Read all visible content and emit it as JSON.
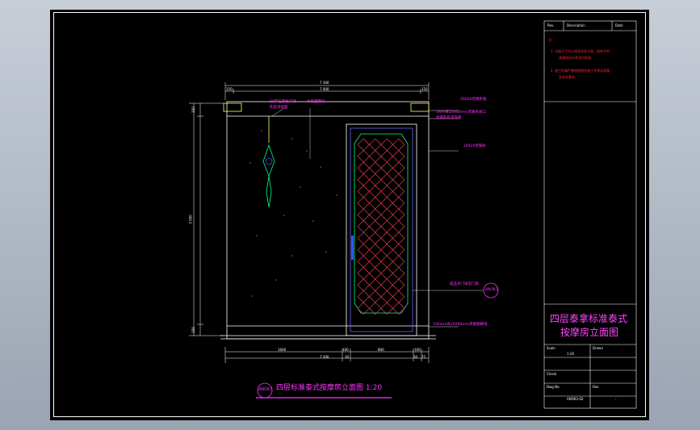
{
  "drawing": {
    "caption_tag": "ANOK3",
    "caption": "四层标准泰式按摩房立面图 1:20",
    "title_block": {
      "header_col1": "Rev.",
      "header_col2": "Description",
      "header_col3": "Date",
      "notes_label": "注:",
      "note_1": "1. 书面尺寸均以现场实际为准，如有不符",
      "note_1b": "请通知设计师及时修改。",
      "note_2": "2. 施工时请严格按照图纸施工并保证质量",
      "note_2b": "及安全要求。",
      "project_title_line1": "四层泰拿标准泰式",
      "project_title_line2": "按摩房立面图",
      "field_scale_label": "Scale",
      "field_scale_value": "1:20",
      "field_drawn_label": "Drawn",
      "field_checked_label": "Check",
      "field_dwg_label": "Dwg No.",
      "field_dwg_value": "ANOK3-02",
      "field_rev_label": "Rev.",
      "field_rev_value": "-"
    },
    "dimensions": {
      "top_total": "7 300",
      "top_left": "150",
      "top_mid": "7 000",
      "top_right": "150",
      "left_total": "3 000",
      "left_top": "150",
      "left_bottom": "150",
      "bottom_1": "1600",
      "bottom_2": "100",
      "bottom_3": "800",
      "bottom_4": "100",
      "bottom_total": "7 300",
      "bottom_a": "30",
      "bottom_b": "30",
      "bottom_c": "75"
    },
    "annotations": {
      "a1": "10厚石膏板吊顶",
      "a1b": "乳胶漆饰面",
      "a2": "木饰面壁灯",
      "a3": "20X20黑钢条框",
      "a4": "5mm厚20X60mm黑钢条收口",
      "a4b": "墙面乳胶漆饰面",
      "a5": "20X20黑钢条",
      "a6": "成品木门详见门表",
      "a6_tag": "ANOK2",
      "a7": "100mm高20X60mm黑钢踢脚线"
    }
  }
}
